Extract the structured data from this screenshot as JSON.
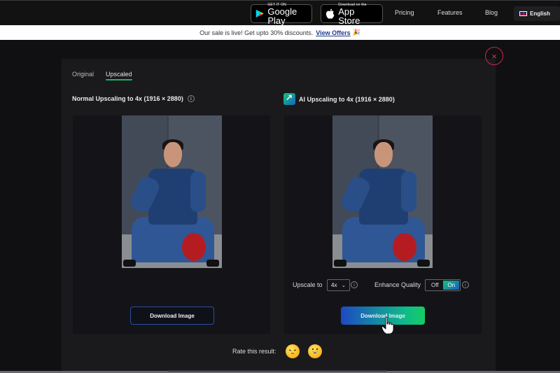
{
  "topnav": {
    "google_play": {
      "small": "GET IT ON",
      "big": "Google Play"
    },
    "app_store": {
      "small": "Download on the",
      "big": "App Store"
    },
    "links": [
      "Pricing",
      "Features",
      "Blog"
    ],
    "language": "English"
  },
  "banner": {
    "text": "Our sale is live! Get upto 30% discounts.",
    "link": "View Offers",
    "emoji": "🎉"
  },
  "modal": {
    "close_icon": "×",
    "tabs": [
      {
        "label": "Original",
        "active": false
      },
      {
        "label": "Upscaled",
        "active": true
      }
    ],
    "left": {
      "title": "Normal Upscaling to 4x (1916 × 2880)",
      "info_icon": "i",
      "download_label": "Download Image"
    },
    "right": {
      "title": "AI Upscaling to 4x (1916 × 2880)",
      "upscale_label": "Upscale to",
      "upscale_value": "4x",
      "chevron": "⌄",
      "info_icon": "i",
      "enhance_label": "Enhance Quality",
      "toggle_off": "Off",
      "toggle_on": "On",
      "toggle_state": "On",
      "download_label": "Download Image"
    },
    "rating": {
      "label": "Rate this result:",
      "emojis": [
        "😔",
        "😀"
      ]
    }
  },
  "colors": {
    "accent_green": "#19b36b",
    "accent_blue": "#1d49c4",
    "close_red": "#c6284a"
  }
}
